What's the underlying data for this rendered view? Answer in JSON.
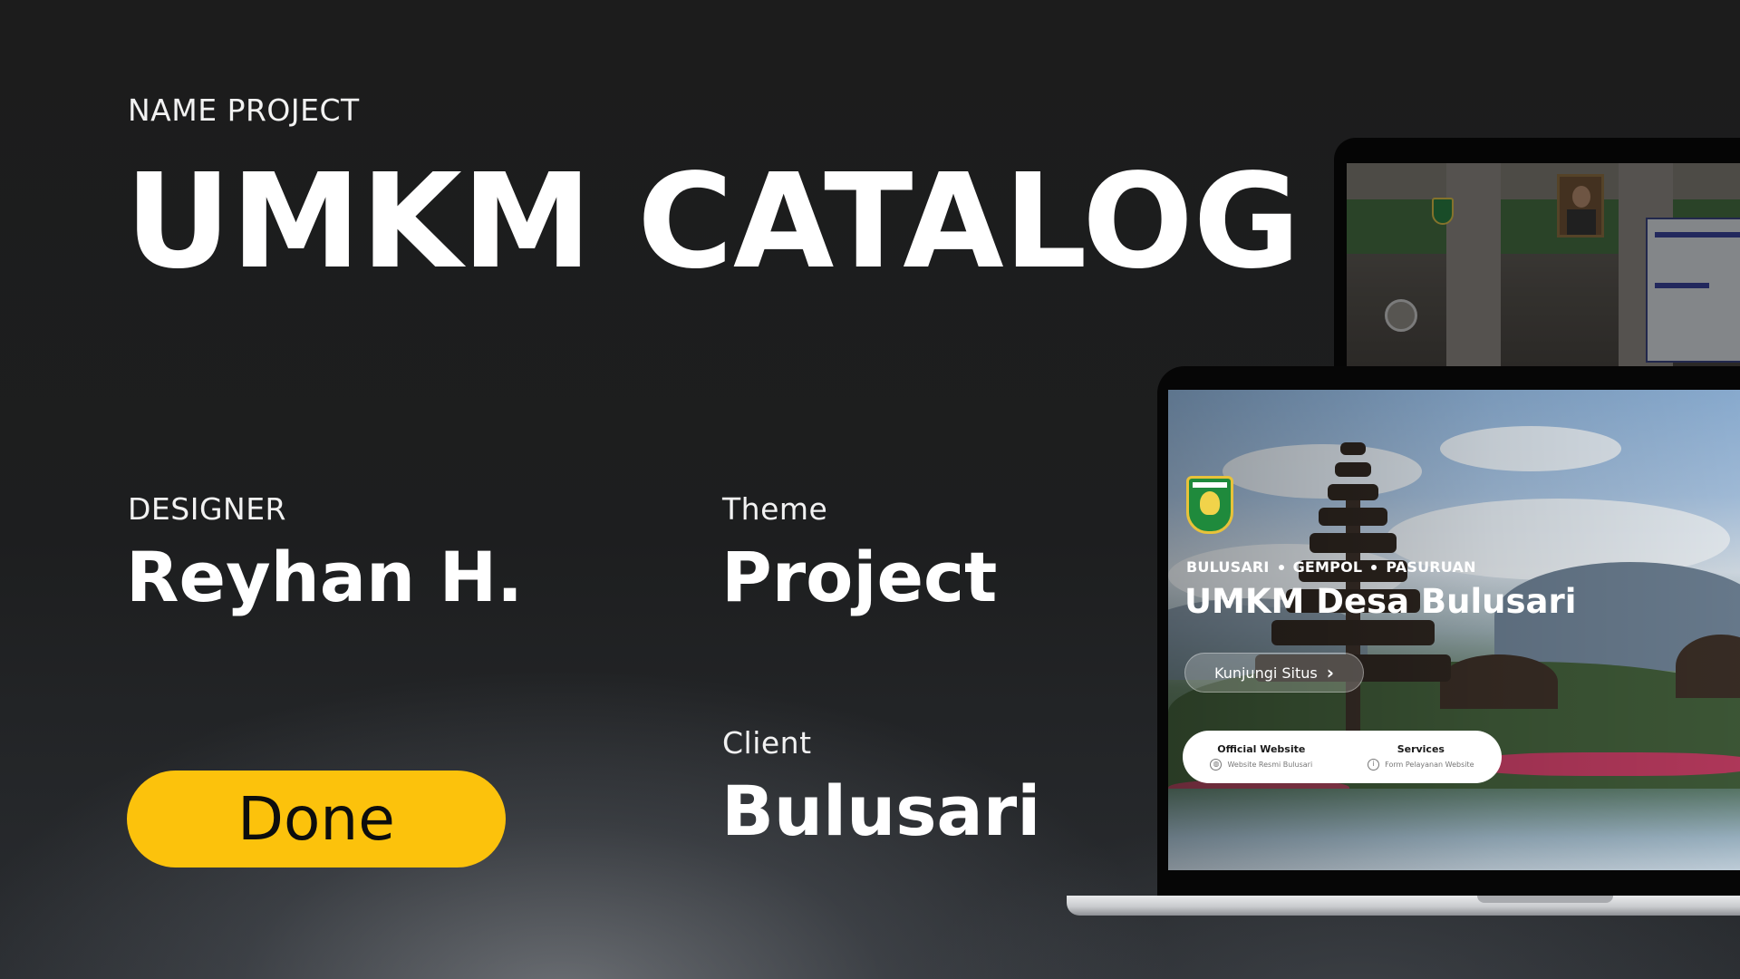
{
  "header": {
    "name_label": "NAME PROJECT",
    "title": "UMKM CATALOG"
  },
  "designer": {
    "label": "DESIGNER",
    "value": "Reyhan H."
  },
  "theme": {
    "label": "Theme",
    "value": "Project"
  },
  "client": {
    "label": "Client",
    "value": "Bulusari"
  },
  "status_button": {
    "label": "Done",
    "color": "#fcc20c"
  },
  "mockup": {
    "breadcrumb": [
      "BULUSARI",
      "GEMPOL",
      "PASURUAN"
    ],
    "site_title": "UMKM Desa Bulusari",
    "visit_button": "Kunjungi Situs",
    "info_card": {
      "official": {
        "title": "Official Website",
        "subtitle": "Website Resmi Bulusari",
        "icon": "globe-icon"
      },
      "services": {
        "title": "Services",
        "subtitle": "Form Pelayanan Website",
        "icon": "info-icon"
      }
    }
  }
}
